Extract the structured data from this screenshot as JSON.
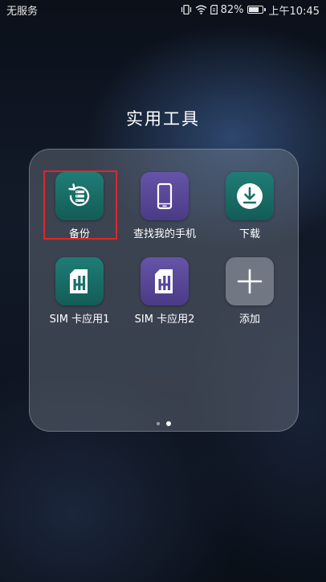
{
  "status_bar": {
    "carrier": "无服务",
    "battery_percent": "82%",
    "battery_level": 0.82,
    "time": "上午10:45"
  },
  "folder": {
    "title": "实用工具",
    "apps": [
      {
        "label": "备份",
        "icon": "backup-icon",
        "color": "#1a6e68"
      },
      {
        "label": "查找我的手机",
        "icon": "find-phone-icon",
        "color": "#5646a0"
      },
      {
        "label": "下载",
        "icon": "download-icon",
        "color": "#1a6e68"
      },
      {
        "label": "SIM 卡应用1",
        "icon": "sim-card-icon",
        "color": "#1a6e68"
      },
      {
        "label": "SIM 卡应用2",
        "icon": "sim-card-icon",
        "color": "#5646a0"
      },
      {
        "label": "添加",
        "icon": "plus-icon",
        "color": "#9096a0"
      }
    ],
    "highlight_color": "#e0262a",
    "pages": 2,
    "active_page": 2
  }
}
